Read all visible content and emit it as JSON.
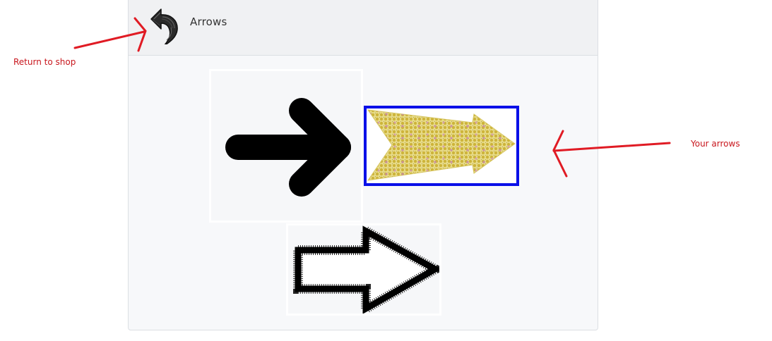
{
  "header": {
    "title": "Arrows"
  },
  "annotations": {
    "return_to_shop": "Return to shop",
    "your_arrows": "Your arrows",
    "color": "#e01b24"
  },
  "arrows": [
    {
      "name": "Bold black arrow",
      "selected": false
    },
    {
      "name": "Dotted gold arrow",
      "selected": true
    },
    {
      "name": "Sketchy outline arrow",
      "selected": false
    }
  ],
  "colors": {
    "selection_border": "#0a10e8",
    "annotation": "#e01b24"
  }
}
